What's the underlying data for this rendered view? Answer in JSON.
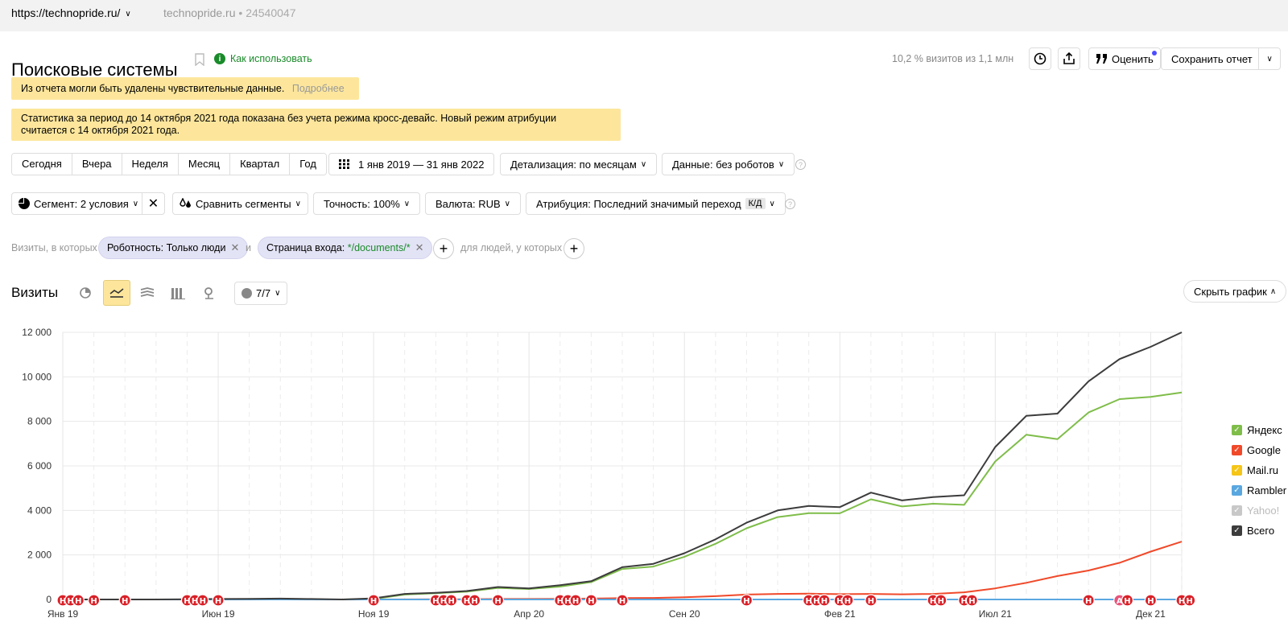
{
  "topbar": {
    "site": "https://technopride.ru/",
    "counter_name": "technopride.ru",
    "counter_sep": "•",
    "counter_id": "24540047"
  },
  "header": {
    "title": "Поисковые системы",
    "howto": "Как использовать",
    "visits_share": "10,2 % визитов из 1,1 млн",
    "rate": "Оценить",
    "save_report": "Сохранить отчет"
  },
  "notices": {
    "sensitive": "Из отчета могли быть удалены чувствительные данные.",
    "more": "Подробнее",
    "crossdevice_line1": "Статистика за период до 14 октября 2021 года показана без учета режима кросс-девайс. Новый режим атрибуции",
    "crossdevice_line2": "считается с 14 октября 2021 года."
  },
  "period": {
    "presets": [
      "Сегодня",
      "Вчера",
      "Неделя",
      "Месяц",
      "Квартал",
      "Год"
    ],
    "range": "1 янв 2019 — 31 янв 2022",
    "detail": "Детализация: по месяцам",
    "data": "Данные: без роботов"
  },
  "toolbar2": {
    "segment": "Сегмент: 2 условия",
    "compare": "Сравнить сегменты",
    "accuracy": "Точность: 100%",
    "currency": "Валюта: RUB",
    "attribution": "Атрибуция: Последний значимый переход",
    "kd": "К/Д"
  },
  "filters": {
    "visits_label": "Визиты, в которых",
    "chip1": "Роботность: Только люди",
    "and": "и",
    "chip2_prefix": "Страница входа: ",
    "chip2_value": "*/documents/*",
    "people_label": "для людей, у которых"
  },
  "chart_header": {
    "title": "Визиты",
    "notes": "7/7",
    "hide": "Скрыть график"
  },
  "legend": [
    {
      "name": "Яндекс",
      "color": "#7fbd4a",
      "enabled": true
    },
    {
      "name": "Google",
      "color": "#f0492a",
      "enabled": true
    },
    {
      "name": "Mail.ru",
      "color": "#f5c518",
      "enabled": true
    },
    {
      "name": "Rambler",
      "color": "#5aa7e0",
      "enabled": true
    },
    {
      "name": "Yahoo!",
      "color": "#c8c8c8",
      "enabled": false
    },
    {
      "name": "Всего",
      "color": "#3c3c3c",
      "enabled": true
    }
  ],
  "chart_data": {
    "type": "line",
    "x": [
      "2019-01",
      "2019-02",
      "2019-03",
      "2019-04",
      "2019-05",
      "2019-06",
      "2019-07",
      "2019-08",
      "2019-09",
      "2019-10",
      "2019-11",
      "2019-12",
      "2020-01",
      "2020-02",
      "2020-03",
      "2020-04",
      "2020-05",
      "2020-06",
      "2020-07",
      "2020-08",
      "2020-09",
      "2020-10",
      "2020-11",
      "2020-12",
      "2021-01",
      "2021-02",
      "2021-03",
      "2021-04",
      "2021-05",
      "2021-06",
      "2021-07",
      "2021-08",
      "2021-09",
      "2021-10",
      "2021-11",
      "2021-12",
      "2022-01"
    ],
    "x_tick_labels": [
      {
        "x": "2019-01",
        "label": "Янв 19"
      },
      {
        "x": "2019-06",
        "label": "Июн 19"
      },
      {
        "x": "2019-11",
        "label": "Ноя 19"
      },
      {
        "x": "2020-04",
        "label": "Апр 20"
      },
      {
        "x": "2020-09",
        "label": "Сен 20"
      },
      {
        "x": "2021-02",
        "label": "Фев 21"
      },
      {
        "x": "2021-07",
        "label": "Июл 21"
      },
      {
        "x": "2021-12",
        "label": "Дек 21"
      }
    ],
    "y_ticks": [
      "0",
      "2 000",
      "4 000",
      "6 000",
      "8 000",
      "10 000",
      "12 000"
    ],
    "ylim": [
      0,
      12000
    ],
    "series": [
      {
        "name": "Яндекс",
        "color": "#7fbd4a",
        "values": [
          0,
          0,
          0,
          0,
          0,
          0,
          0,
          0,
          0,
          0,
          20,
          220,
          280,
          350,
          520,
          470,
          580,
          780,
          1370,
          1480,
          1920,
          2500,
          3200,
          3700,
          3880,
          3870,
          4500,
          4180,
          4300,
          4250,
          6200,
          7400,
          7200,
          8400,
          9000,
          9100,
          9300
        ]
      },
      {
        "name": "Google",
        "color": "#f0492a",
        "values": [
          0,
          0,
          0,
          0,
          0,
          0,
          0,
          0,
          0,
          0,
          0,
          5,
          10,
          10,
          20,
          20,
          30,
          40,
          60,
          70,
          100,
          150,
          220,
          250,
          260,
          240,
          250,
          230,
          250,
          320,
          500,
          750,
          1050,
          1300,
          1650,
          2150,
          2600
        ]
      },
      {
        "name": "Mail.ru",
        "color": "#f5c518",
        "values": [
          0,
          0,
          0,
          0,
          0,
          0,
          0,
          0,
          0,
          0,
          0,
          0,
          0,
          0,
          0,
          0,
          0,
          0,
          0,
          0,
          0,
          0,
          0,
          0,
          0,
          0,
          0,
          0,
          0,
          0,
          0,
          0,
          0,
          0,
          0,
          0,
          0
        ]
      },
      {
        "name": "Rambler",
        "color": "#5aa7e0",
        "values": [
          0,
          0,
          0,
          0,
          0,
          0,
          0,
          0,
          0,
          0,
          0,
          0,
          0,
          0,
          0,
          0,
          0,
          0,
          0,
          0,
          0,
          0,
          0,
          0,
          0,
          0,
          0,
          0,
          0,
          0,
          0,
          0,
          0,
          0,
          0,
          0,
          0
        ]
      },
      {
        "name": "Всего",
        "color": "#3c3c3c",
        "values": [
          0,
          0,
          0,
          0,
          10,
          20,
          30,
          40,
          20,
          0,
          50,
          250,
          300,
          380,
          560,
          500,
          640,
          820,
          1450,
          1600,
          2080,
          2700,
          3450,
          4000,
          4200,
          4150,
          4800,
          4450,
          4600,
          4680,
          6850,
          8250,
          8350,
          9800,
          10800,
          11350,
          12000
        ]
      }
    ],
    "note_marker_text": "Н",
    "note_marker_alt_text": "А"
  }
}
